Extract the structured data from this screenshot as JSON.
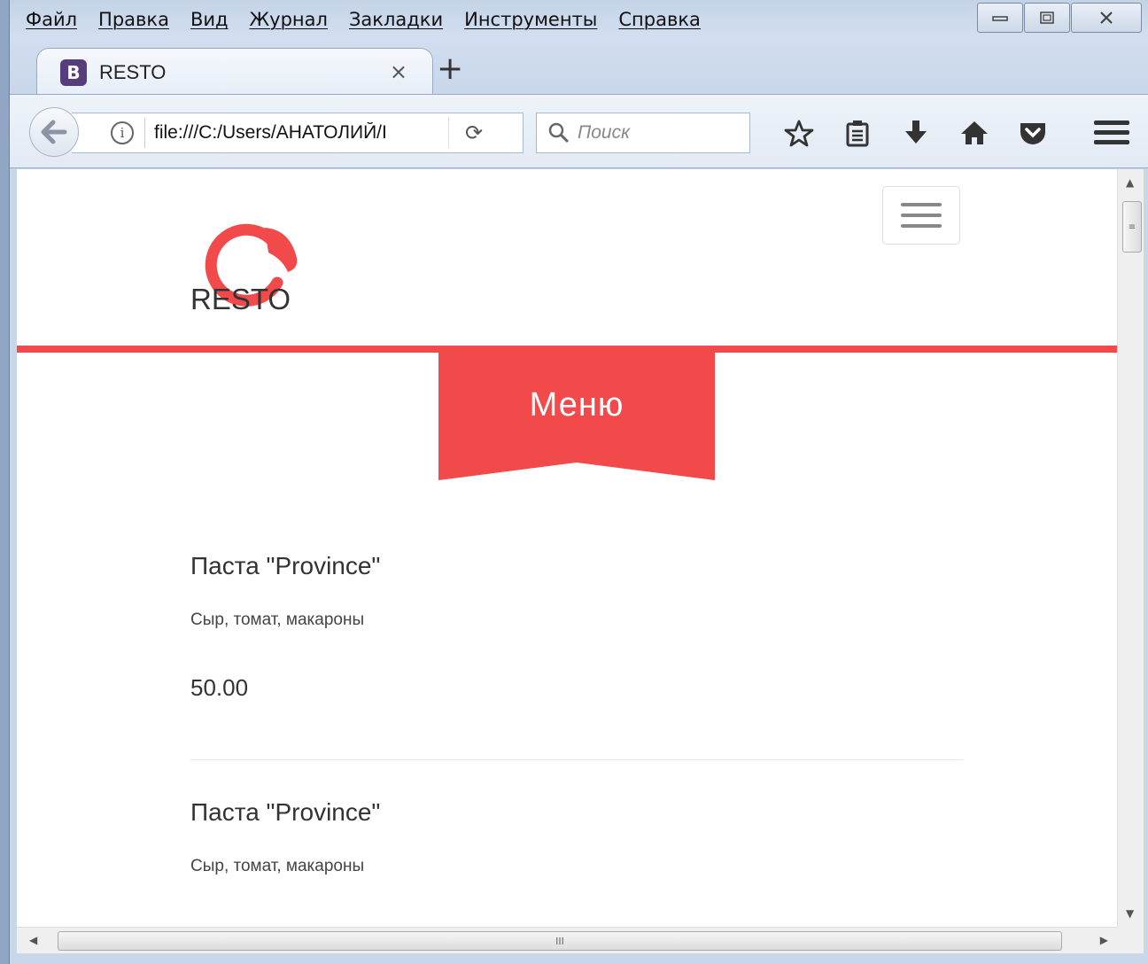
{
  "menubar": {
    "items": [
      "Файл",
      "Правка",
      "Вид",
      "Журнал",
      "Закладки",
      "Инструменты",
      "Справка"
    ]
  },
  "tab": {
    "favicon_letter": "B",
    "title": "RESTO",
    "close": "×",
    "new_tab": "+"
  },
  "navbar": {
    "url": "file:///C:/Users/АНАТОЛИЙ/I",
    "search_placeholder": "Поиск",
    "info_glyph": "i",
    "reload_glyph": "⟳"
  },
  "page": {
    "brand": "RESTO",
    "section_title": "Меню",
    "accent_color": "#f2494b",
    "items": [
      {
        "name": "Паста \"Province\"",
        "desc": "Сыр, томат, макароны",
        "price": "50.00"
      },
      {
        "name": "Паста \"Province\"",
        "desc": "Сыр, томат, макароны"
      }
    ]
  },
  "scrollbar": {
    "grip": "≡",
    "hgrip": "III"
  }
}
